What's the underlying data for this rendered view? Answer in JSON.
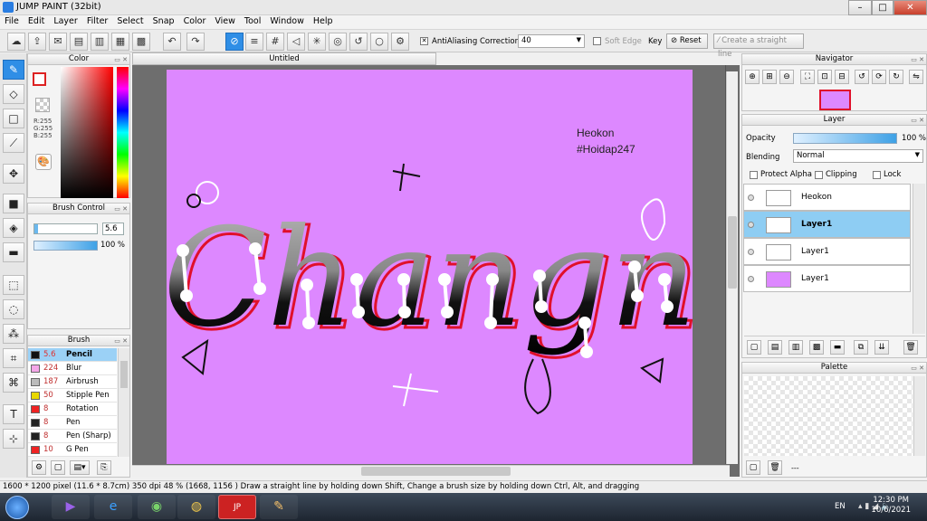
{
  "window": {
    "title": "JUMP PAINT (32bit)"
  },
  "menu": [
    "File",
    "Edit",
    "Layer",
    "Filter",
    "Select",
    "Snap",
    "Color",
    "View",
    "Tool",
    "Window",
    "Help"
  ],
  "toolbar": {
    "antialiasing_label": "AntiAliasing",
    "correction_label": "Correction",
    "correction_value": "40",
    "soft_edge_label": "Soft Edge",
    "key_label": "Key",
    "reset_label": "Reset",
    "straight_line_label": "Create a straight line"
  },
  "color_panel": {
    "title": "Color",
    "r": "R:255",
    "g": "G:255",
    "b": "B:255"
  },
  "brush_control": {
    "title": "Brush Control",
    "size": "5.6",
    "opacity": "100 %"
  },
  "brush_panel": {
    "title": "Brush",
    "items": [
      {
        "size": "5.6",
        "name": "Pencil",
        "color": "#111111",
        "selected": true
      },
      {
        "size": "224",
        "name": "Blur",
        "color": "#f4a6e8",
        "selected": false
      },
      {
        "size": "187",
        "name": "Airbrush",
        "color": "#bbbbbb",
        "selected": false
      },
      {
        "size": "50",
        "name": "Stipple Pen",
        "color": "#e8d800",
        "selected": false
      },
      {
        "size": "8",
        "name": "Rotation Symi",
        "color": "#ee2222",
        "selected": false
      },
      {
        "size": "8",
        "name": "Pen",
        "color": "#222222",
        "selected": false
      },
      {
        "size": "8",
        "name": "Pen (Sharp)",
        "color": "#222222",
        "selected": false
      },
      {
        "size": "10",
        "name": "G Pen",
        "color": "#ee2222",
        "selected": false
      }
    ]
  },
  "document": {
    "tab": "Untitled",
    "credit_name": "Heokon",
    "credit_tag": "#Hoidap247",
    "artwork_word": "Changne",
    "background": "#dd88ff"
  },
  "navigator": {
    "title": "Navigator"
  },
  "layer_panel": {
    "title": "Layer",
    "opacity_label": "Opacity",
    "opacity_value": "100 %",
    "blending_label": "Blending",
    "blending_value": "Normal",
    "protect_alpha": "Protect Alpha",
    "clipping": "Clipping",
    "lock": "Lock",
    "layers": [
      {
        "name": "Heokon",
        "selected": false
      },
      {
        "name": "Layer1",
        "selected": true
      },
      {
        "name": "Layer1",
        "selected": false
      },
      {
        "name": "Layer1",
        "selected": false
      }
    ]
  },
  "palette": {
    "title": "Palette",
    "footer": "---"
  },
  "status": {
    "size": "1600 * 1200 pixel",
    "cm": "(11.6 * 8.7cm)",
    "dpi": "350 dpi",
    "zoom": "48 %",
    "cursor": "(1668, 1156 )",
    "hint": "Draw a straight line by holding down Shift, Change a brush size by holding down Ctrl, Alt, and dragging"
  },
  "taskbar": {
    "lang": "EN",
    "time": "12:30 PM",
    "date": "10/6/2021"
  }
}
